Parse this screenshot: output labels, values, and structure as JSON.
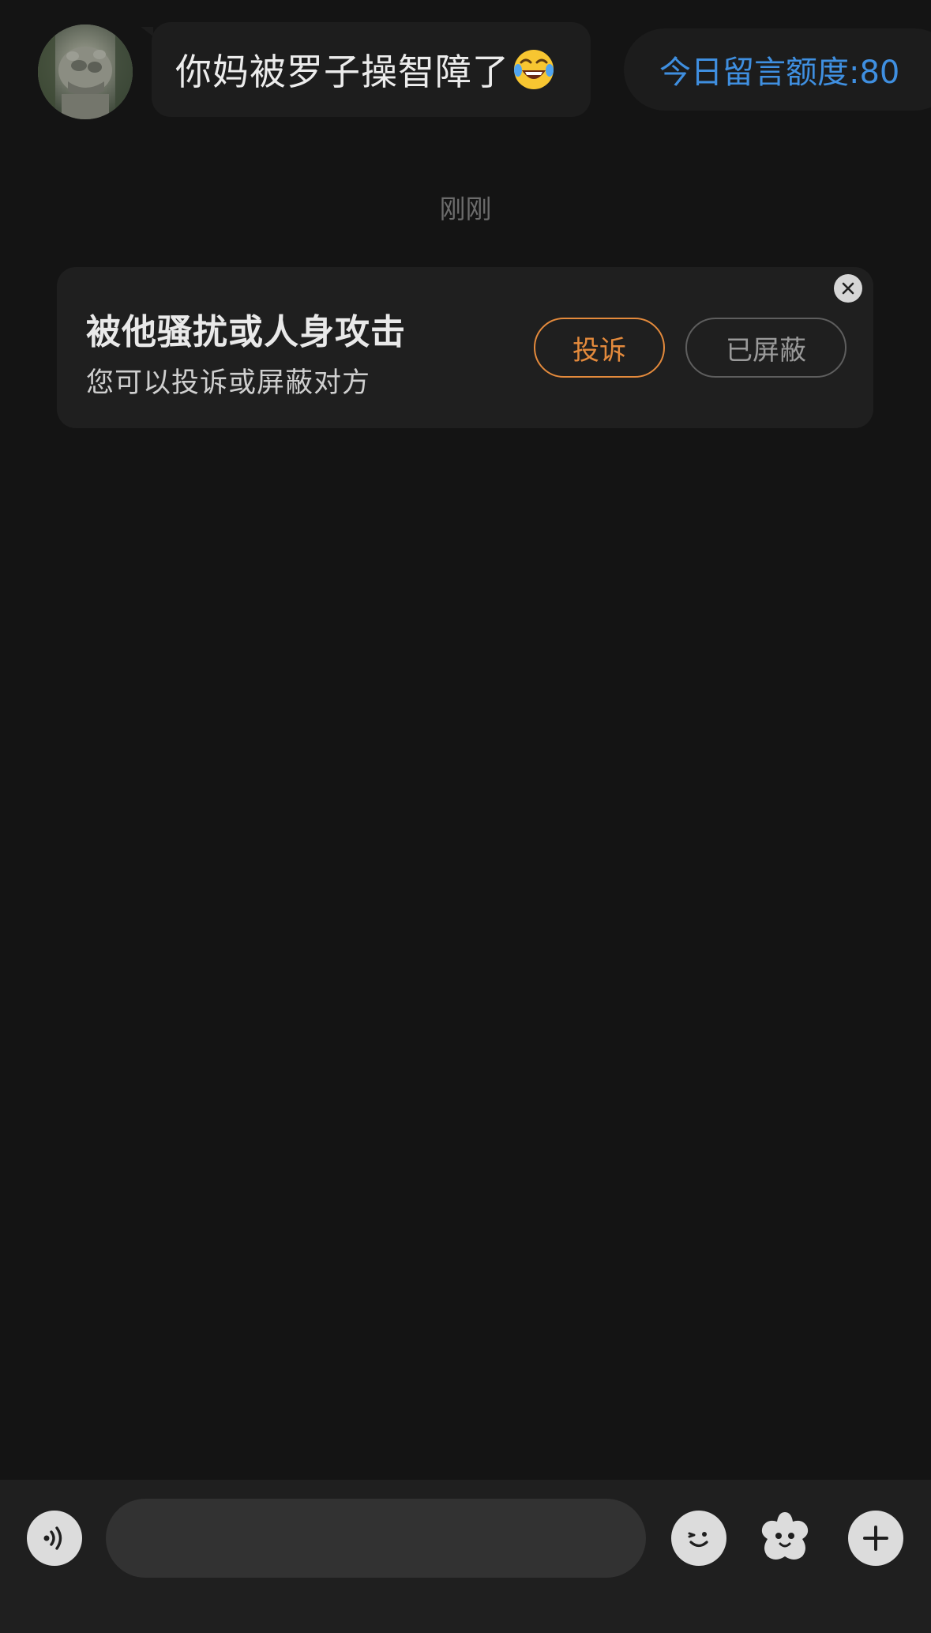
{
  "message": {
    "avatar_icon": "stone-lion-avatar",
    "text": "你妈被罗子操智障了",
    "emoji": "face-with-tears-of-joy-icon"
  },
  "quota": {
    "label": "今日留言额度:80"
  },
  "timestamp": "刚刚",
  "harassment_card": {
    "title": "被他骚扰或人身攻击",
    "subtitle": "您可以投诉或屏蔽对方",
    "complain_label": "投诉",
    "blocked_label": "已屏蔽",
    "close_icon": "close-icon"
  },
  "input_bar": {
    "voice_icon": "voice-icon",
    "text_value": "",
    "emoji_icon": "smiley-icon",
    "sticker_icon": "sticker-icon",
    "plus_icon": "plus-icon"
  },
  "colors": {
    "background": "#141414",
    "accent_blue": "#3f8fe0",
    "accent_orange": "#e48a3c",
    "card_bg": "#1f1f1f",
    "bubble_bg": "#1d1d1d"
  }
}
